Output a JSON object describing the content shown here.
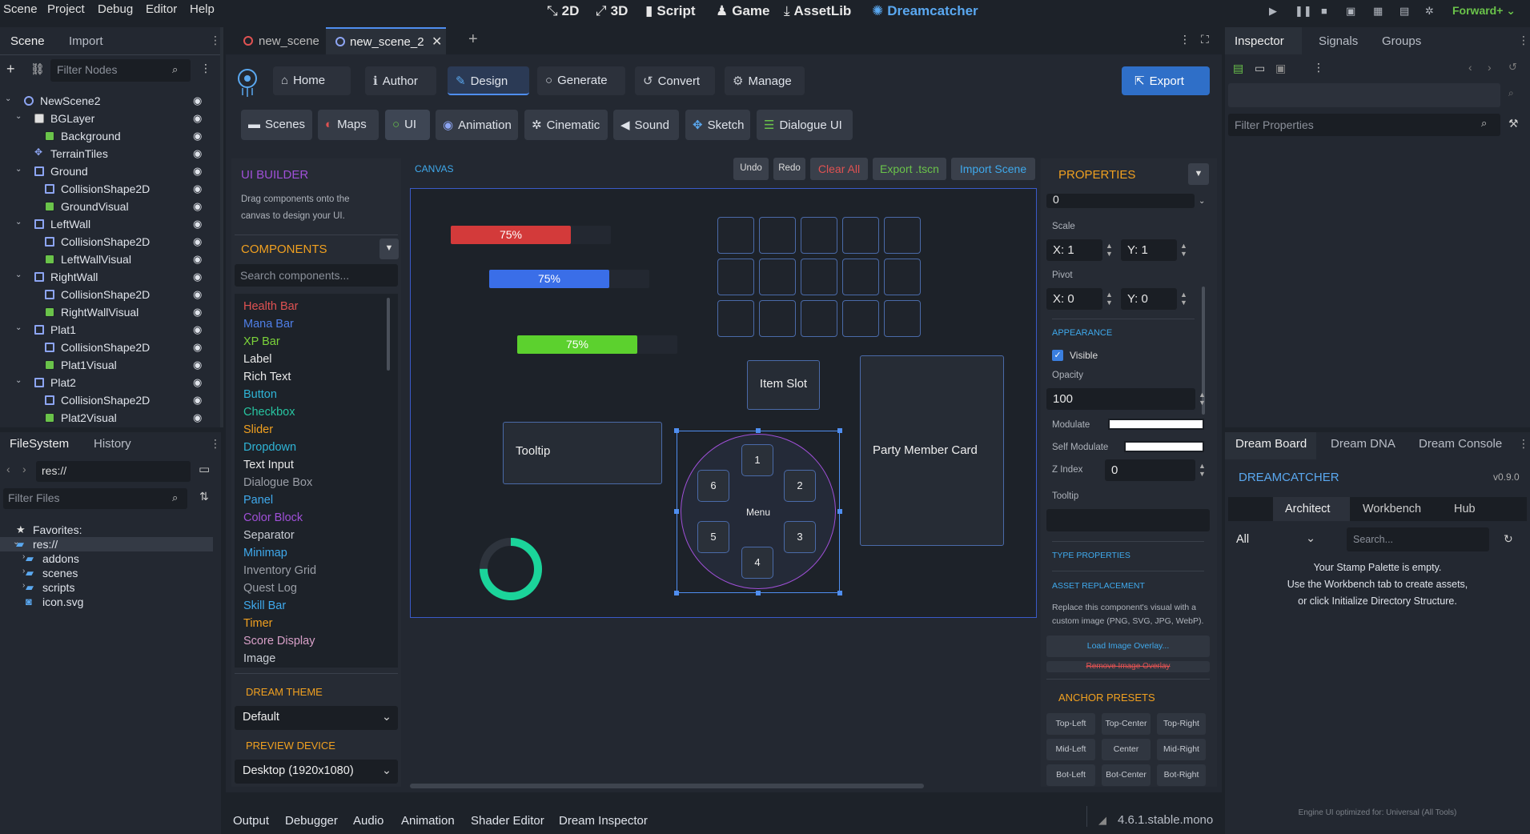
{
  "menu": [
    "Scene",
    "Project",
    "Debug",
    "Editor",
    "Help"
  ],
  "workspaces": {
    "w2d": "2D",
    "w3d": "3D",
    "script": "Script",
    "game": "Game",
    "assetlib": "AssetLib",
    "dream": "Dreamcatcher"
  },
  "renderer": "Forward+",
  "scene_dock": {
    "tabs": [
      "Scene",
      "Import"
    ],
    "filter_placeholder": "Filter Nodes",
    "nodes": [
      {
        "name": "NewScene2",
        "depth": 0,
        "icon": "node",
        "arrow": true
      },
      {
        "name": "BGLayer",
        "depth": 1,
        "icon": "bg",
        "arrow": true
      },
      {
        "name": "Background",
        "depth": 2,
        "icon": "vis",
        "arrow": false
      },
      {
        "name": "TerrainTiles",
        "depth": 1,
        "icon": "tile",
        "arrow": false
      },
      {
        "name": "Ground",
        "depth": 1,
        "icon": "coll",
        "arrow": true
      },
      {
        "name": "CollisionShape2D",
        "depth": 2,
        "icon": "coll",
        "arrow": false
      },
      {
        "name": "GroundVisual",
        "depth": 2,
        "icon": "vis",
        "arrow": false
      },
      {
        "name": "LeftWall",
        "depth": 1,
        "icon": "coll",
        "arrow": true
      },
      {
        "name": "CollisionShape2D",
        "depth": 2,
        "icon": "coll",
        "arrow": false
      },
      {
        "name": "LeftWallVisual",
        "depth": 2,
        "icon": "vis",
        "arrow": false
      },
      {
        "name": "RightWall",
        "depth": 1,
        "icon": "coll",
        "arrow": true
      },
      {
        "name": "CollisionShape2D",
        "depth": 2,
        "icon": "coll",
        "arrow": false
      },
      {
        "name": "RightWallVisual",
        "depth": 2,
        "icon": "vis",
        "arrow": false
      },
      {
        "name": "Plat1",
        "depth": 1,
        "icon": "coll",
        "arrow": true
      },
      {
        "name": "CollisionShape2D",
        "depth": 2,
        "icon": "coll",
        "arrow": false
      },
      {
        "name": "Plat1Visual",
        "depth": 2,
        "icon": "vis",
        "arrow": false
      },
      {
        "name": "Plat2",
        "depth": 1,
        "icon": "coll",
        "arrow": true
      },
      {
        "name": "CollisionShape2D",
        "depth": 2,
        "icon": "coll",
        "arrow": false
      },
      {
        "name": "Plat2Visual",
        "depth": 2,
        "icon": "vis",
        "arrow": false
      }
    ]
  },
  "fs_dock": {
    "tabs": [
      "FileSystem",
      "History"
    ],
    "path": "res://",
    "filter_placeholder": "Filter Files",
    "items": [
      {
        "name": "Favorites:",
        "depth": 0,
        "icon": "star"
      },
      {
        "name": "res://",
        "depth": 0,
        "icon": "folder",
        "selected": true
      },
      {
        "name": "addons",
        "depth": 1,
        "icon": "folder"
      },
      {
        "name": "scenes",
        "depth": 1,
        "icon": "folder"
      },
      {
        "name": "scripts",
        "depth": 1,
        "icon": "folder"
      },
      {
        "name": "icon.svg",
        "depth": 1,
        "icon": "file"
      }
    ]
  },
  "editor_tabs": [
    "new_scene",
    "new_scene_2"
  ],
  "dream_nav": [
    "Home",
    "Author",
    "Design",
    "Generate",
    "Convert",
    "Manage"
  ],
  "export_label": "Export",
  "design_tabs": [
    "Scenes",
    "Maps",
    "UI",
    "Animation",
    "Cinematic",
    "Sound",
    "Sketch",
    "Dialogue UI"
  ],
  "ui_builder": {
    "title": "UI BUILDER",
    "desc1": "Drag components onto the",
    "desc2": "canvas to design your UI.",
    "components_title": "COMPONENTS",
    "search_placeholder": "Search components...",
    "components": [
      {
        "name": "Health Bar",
        "color": "#e05252"
      },
      {
        "name": "Mana Bar",
        "color": "#4f7fe8"
      },
      {
        "name": "XP Bar",
        "color": "#7bd33a"
      },
      {
        "name": "Label",
        "color": "#e8e8e8"
      },
      {
        "name": "Rich Text",
        "color": "#e8e8e8"
      },
      {
        "name": "Button",
        "color": "#2fb4d6"
      },
      {
        "name": "Checkbox",
        "color": "#27c4a0"
      },
      {
        "name": "Slider",
        "color": "#f0a020"
      },
      {
        "name": "Dropdown",
        "color": "#2fb4d6"
      },
      {
        "name": "Text Input",
        "color": "#e8e8e8"
      },
      {
        "name": "Dialogue Box",
        "color": "#9a9ea6"
      },
      {
        "name": "Panel",
        "color": "#3fa9ec"
      },
      {
        "name": "Color Block",
        "color": "#a050d8"
      },
      {
        "name": "Separator",
        "color": "#c8ccd3"
      },
      {
        "name": "Minimap",
        "color": "#3fa9ec"
      },
      {
        "name": "Inventory Grid",
        "color": "#9a9ea6"
      },
      {
        "name": "Quest Log",
        "color": "#9a9ea6"
      },
      {
        "name": "Skill Bar",
        "color": "#3fa9ec"
      },
      {
        "name": "Timer",
        "color": "#f0a020"
      },
      {
        "name": "Score Display",
        "color": "#d8a0c8"
      },
      {
        "name": "Image",
        "color": "#c8ccd3"
      }
    ],
    "theme_title": "DREAM THEME",
    "theme_value": "Default",
    "device_title": "PREVIEW DEVICE",
    "device_value": "Desktop (1920x1080)"
  },
  "canvas": {
    "title": "CANVAS",
    "undo": "Undo",
    "redo": "Redo",
    "clear": "Clear All",
    "export": "Export .tscn",
    "import": "Import Scene",
    "bars": [
      {
        "label": "75%",
        "fill": 0.75,
        "color": "#d33a3a"
      },
      {
        "label": "75%",
        "fill": 0.75,
        "color": "#3a6ee8"
      },
      {
        "label": "75%",
        "fill": 0.75,
        "color": "#5cd12e"
      }
    ],
    "item_slot": "Item Slot",
    "tooltip": "Tooltip",
    "party_card": "Party Member Card",
    "menu": "Menu",
    "radial": [
      "1",
      "2",
      "3",
      "4",
      "5",
      "6"
    ],
    "ring_progress": 0.75
  },
  "properties": {
    "title": "PROPERTIES",
    "top_value": "0",
    "scale_label": "Scale",
    "scale_x": "X: 1",
    "scale_y": "Y: 1",
    "pivot_label": "Pivot",
    "pivot_x": "X: 0",
    "pivot_y": "Y: 0",
    "appearance": "APPEARANCE",
    "visible": "Visible",
    "opacity_label": "Opacity",
    "opacity": "100",
    "modulate": "Modulate",
    "self_modulate": "Self Modulate",
    "zindex_label": "Z Index",
    "zindex": "0",
    "tooltip_label": "Tooltip",
    "type_props": "TYPE PROPERTIES",
    "asset_repl": "ASSET REPLACEMENT",
    "asset_desc1": "Replace this component's visual with a",
    "asset_desc2": "custom image (PNG, SVG, JPG, WebP).",
    "load_overlay": "Load Image Overlay...",
    "remove_overlay": "Remove Image Overlay",
    "anchor_title": "ANCHOR PRESETS",
    "anchors": [
      "Top-Left",
      "Top-Center",
      "Top-Right",
      "Mid-Left",
      "Center",
      "Mid-Right",
      "Bot-Left",
      "Bot-Center",
      "Bot-Right"
    ]
  },
  "inspector": {
    "tabs": [
      "Inspector",
      "Signals",
      "Groups"
    ],
    "filter_placeholder": "Filter Properties"
  },
  "dream_board": {
    "tabs": [
      "Dream Board",
      "Dream DNA",
      "Dream Console"
    ],
    "title": "DREAMCATCHER",
    "version": "v0.9.0",
    "subtabs": [
      "Architect",
      "Workbench",
      "Hub"
    ],
    "filter": "All",
    "search_placeholder": "Search...",
    "empty1": "Your Stamp Palette is empty.",
    "empty2": "Use the Workbench tab to create assets,",
    "empty3": "or click Initialize Directory Structure.",
    "footer": "Engine UI optimized for: Universal (All Tools)"
  },
  "bottom_tabs": [
    "Output",
    "Debugger",
    "Audio",
    "Animation",
    "Shader Editor",
    "Dream Inspector"
  ],
  "version": "4.6.1.stable.mono"
}
